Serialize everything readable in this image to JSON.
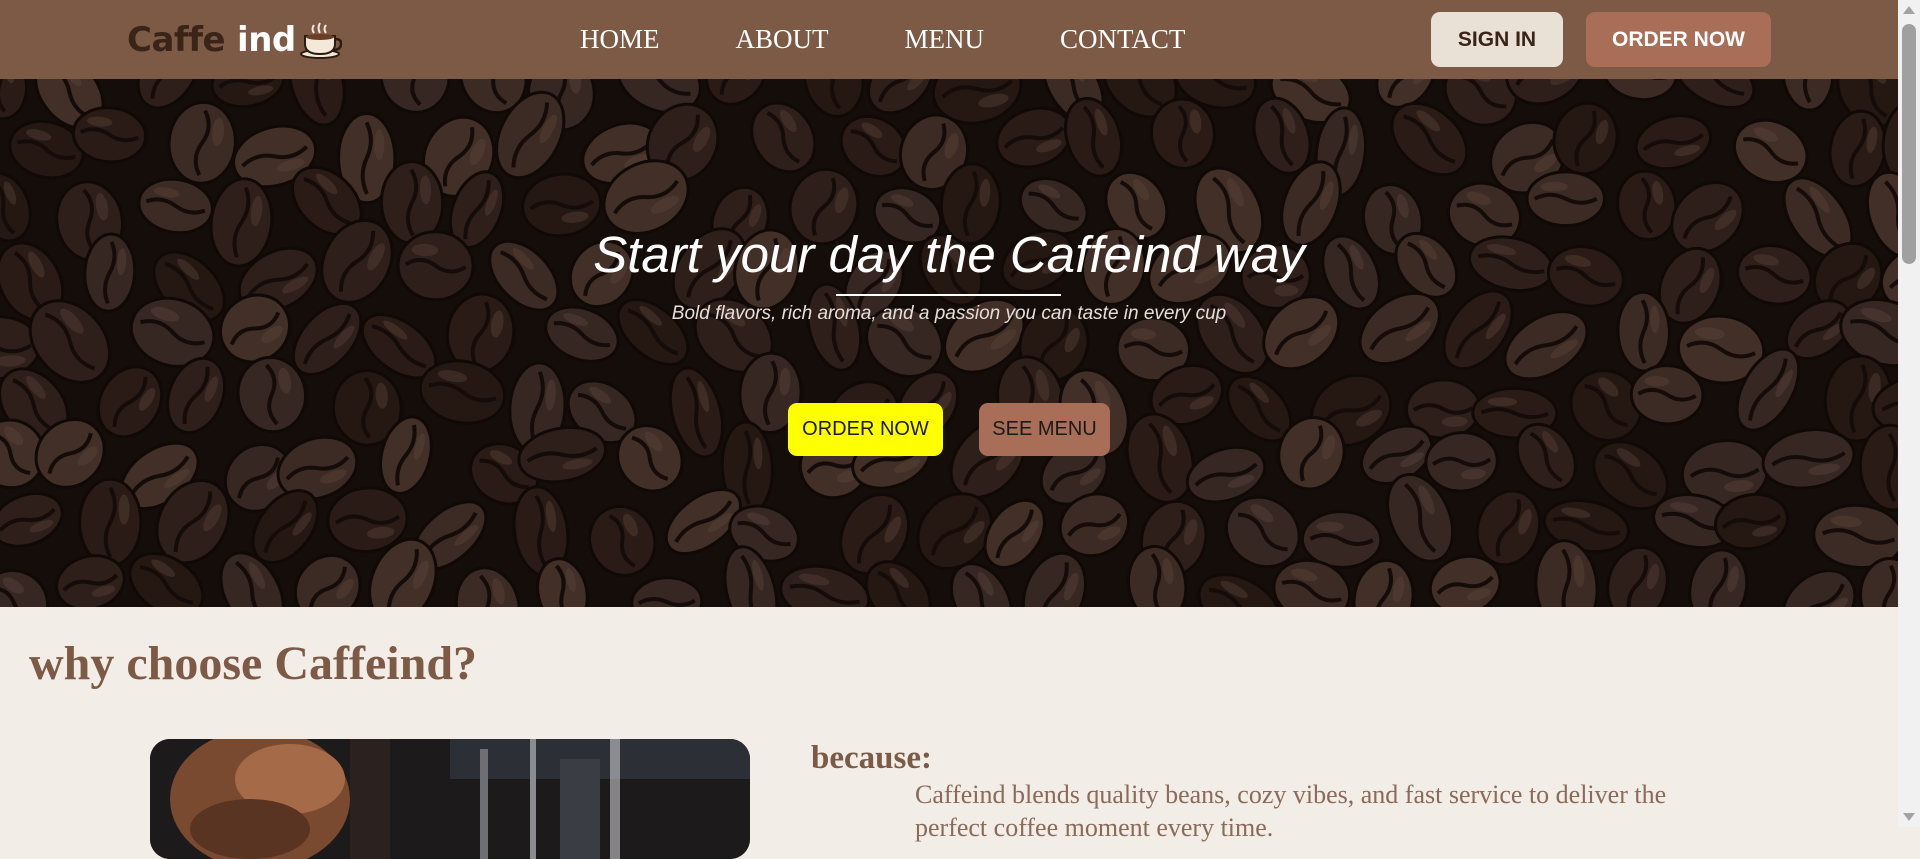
{
  "colors": {
    "nav_bg": "#7d5a46",
    "page_bg": "#f3ede7",
    "accent_yellow": "#ffff00",
    "accent_brown": "#a86e57",
    "heading_brown": "#7d5a46"
  },
  "nav": {
    "logo_part1": "Caffe",
    "logo_part2": "ind",
    "logo_icon": "coffee-cup-icon",
    "links": [
      "HOME",
      "ABOUT",
      "MENU",
      "CONTACT"
    ],
    "sign_in": "SIGN IN",
    "order_now": "ORDER NOW"
  },
  "hero": {
    "title": "Start your day the Caffeind way",
    "subtitle": "Bold flavors, rich aroma, and a passion you can taste in every cup",
    "order_button": "ORDER NOW",
    "menu_button": "SEE MENU"
  },
  "why": {
    "heading": "why choose Caffeind?",
    "because_label": "because:",
    "because_text": "Caffeind blends quality beans, cozy vibes, and fast service to deliver the perfect coffee moment every time."
  }
}
